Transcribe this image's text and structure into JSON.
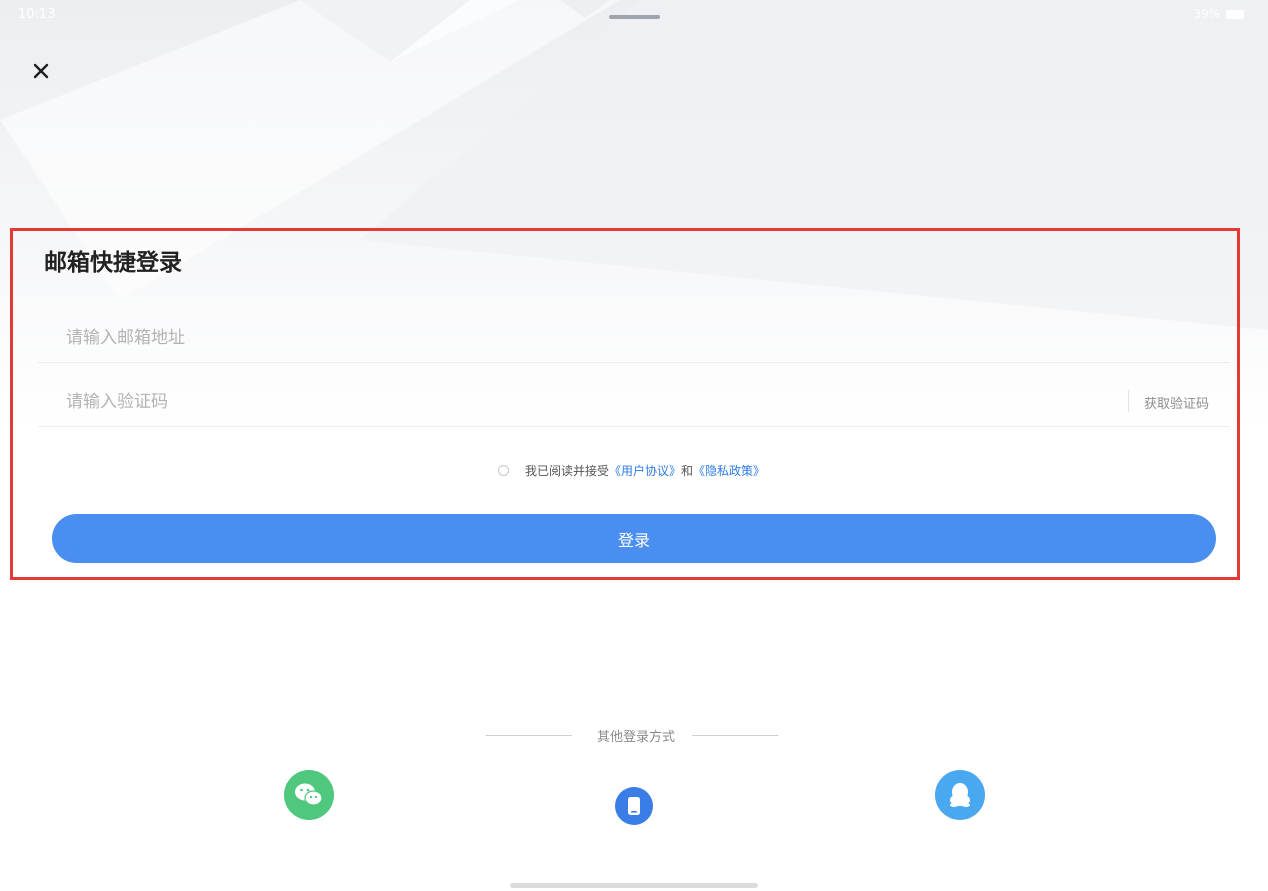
{
  "status_bar": {
    "time": "10:13",
    "right": "39%"
  },
  "form": {
    "title": "邮箱快捷登录",
    "email_placeholder": "请输入邮箱地址",
    "code_placeholder": "请输入验证码",
    "get_code_label": "获取验证码"
  },
  "agreement": {
    "prefix": "我已阅读并接受",
    "user_agreement": "《用户协议》",
    "connector": "和",
    "privacy_policy": "《隐私政策》"
  },
  "login_button": "登录",
  "other_login": {
    "label": "其他登录方式",
    "methods": [
      {
        "name": "wechat",
        "icon": "wechat-icon",
        "color": "#4fc77d"
      },
      {
        "name": "phone",
        "icon": "phone-icon",
        "color": "#3b7de6"
      },
      {
        "name": "qq",
        "icon": "qq-icon",
        "color": "#4aa8f0"
      }
    ]
  },
  "colors": {
    "primary": "#4a8ff0",
    "link": "#2d7be5",
    "highlight": "#e53935"
  }
}
